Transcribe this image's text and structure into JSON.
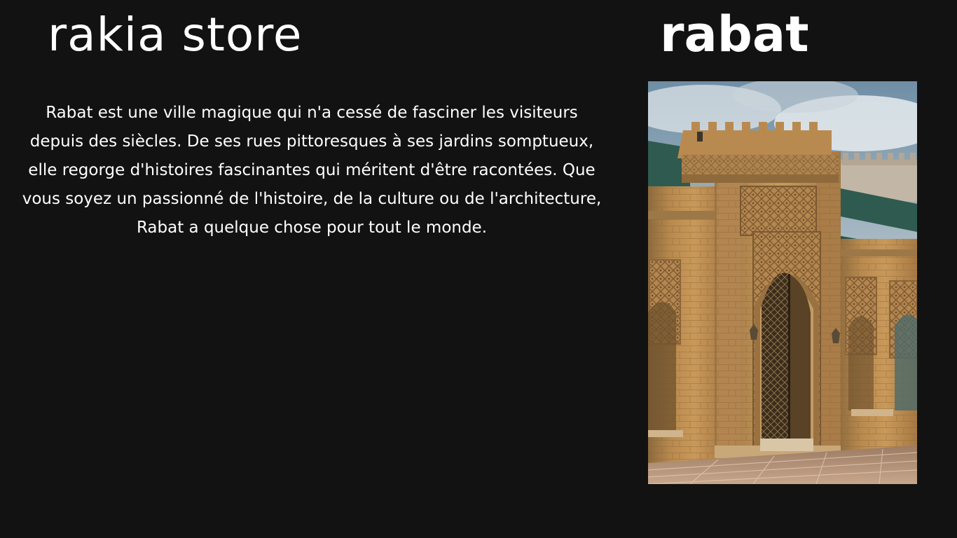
{
  "header": {
    "store_name": "rakia store",
    "city_name": "rabat"
  },
  "main": {
    "description": "Rabat est une ville magique qui n'a cessé de fasciner les visiteurs depuis des siècles. De ses rues pittoresques à ses jardins somptueux, elle regorge d'histoires fascinantes qui méritent d'être racontées. Que vous soyez un passionné de l'histoire, de la culture ou de l'architecture, Rabat a quelque chose pour tout le monde."
  },
  "colors": {
    "background": "#121212",
    "text": "#ffffff",
    "sandstone": "#b98a4e",
    "roof_green": "#2f5a4f",
    "sky": "#8aa2b4"
  },
  "image": {
    "icon": "moroccan-gate-photo"
  }
}
